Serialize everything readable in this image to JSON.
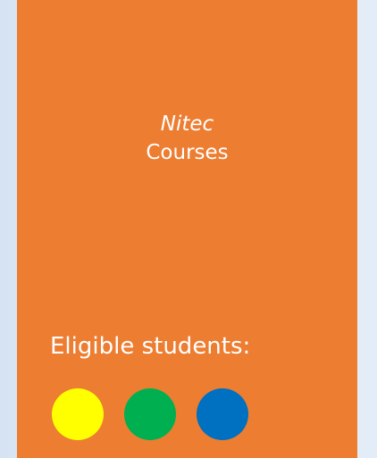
{
  "card": {
    "title_italic": "Nitec",
    "title": "Courses",
    "eligible_label": "Eligible students:",
    "background_color": "#ED7D31"
  },
  "eligible_dots": [
    {
      "icon": "yellow-circle-icon",
      "color": "#FFFF00"
    },
    {
      "icon": "green-circle-icon",
      "color": "#00B050"
    },
    {
      "icon": "blue-circle-icon",
      "color": "#0070C0"
    }
  ]
}
